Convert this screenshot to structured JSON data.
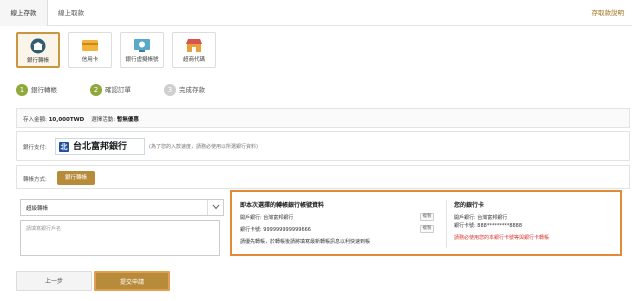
{
  "tabs": {
    "online_deposit": "線上存款",
    "online_withdraw": "線上取款",
    "right_link": "存取款說明"
  },
  "methods": [
    {
      "label": "銀行轉帳",
      "icon": "bank-transfer-icon",
      "active": true
    },
    {
      "label": "信用卡",
      "icon": "credit-card-icon",
      "active": false
    },
    {
      "label": "銀行虛擬帳號",
      "icon": "virtual-account-icon",
      "active": false
    },
    {
      "label": "超商代碼",
      "icon": "convenience-store-icon",
      "active": false
    }
  ],
  "steps": [
    {
      "num": "1",
      "label": "銀行轉帳"
    },
    {
      "num": "2",
      "label": "確認訂單"
    },
    {
      "num": "3",
      "label": "完成存款"
    }
  ],
  "summary": {
    "amount_label": "存入金額:",
    "amount_value": "10,000TWD",
    "promo_label": "選擇活動:",
    "promo_value": "暫無優惠"
  },
  "bank": {
    "label": "銀行支付:",
    "logo_text": "台北富邦銀行",
    "logo_mark": "北",
    "note": "(為了您的入款速度，請務必使用以所選銀行資料)"
  },
  "transfer": {
    "label": "轉帳方式:",
    "value": "銀行轉帳"
  },
  "form": {
    "select_value": "超級轉帳",
    "textarea_placeholder": "請填寫銀行戶名"
  },
  "recipient": {
    "title": "即本次選擇的轉帳銀行帳號資料",
    "account_name": "開戶銀行: 台灣富邦銀行",
    "account_no": "銀行卡號: 999999999999666",
    "note": "請優先轉帳，於轉帳後請將填寫最新轉帳訊息以利快速到帳",
    "copy_label": "複製"
  },
  "my_card": {
    "title": "您的銀行卡",
    "bank": "開戶銀行: 台灣富邦銀行",
    "card_no": "銀行卡號: 888*********8888",
    "warning": "請務必使用您的本銀行卡號等與銀行卡轉帳"
  },
  "buttons": {
    "prev": "上一步",
    "submit": "提交申請"
  },
  "colors": {
    "accent": "#b88b3a",
    "highlight_border": "#e28a3a",
    "step_done": "#8fa83a",
    "warning": "#d8352c"
  }
}
